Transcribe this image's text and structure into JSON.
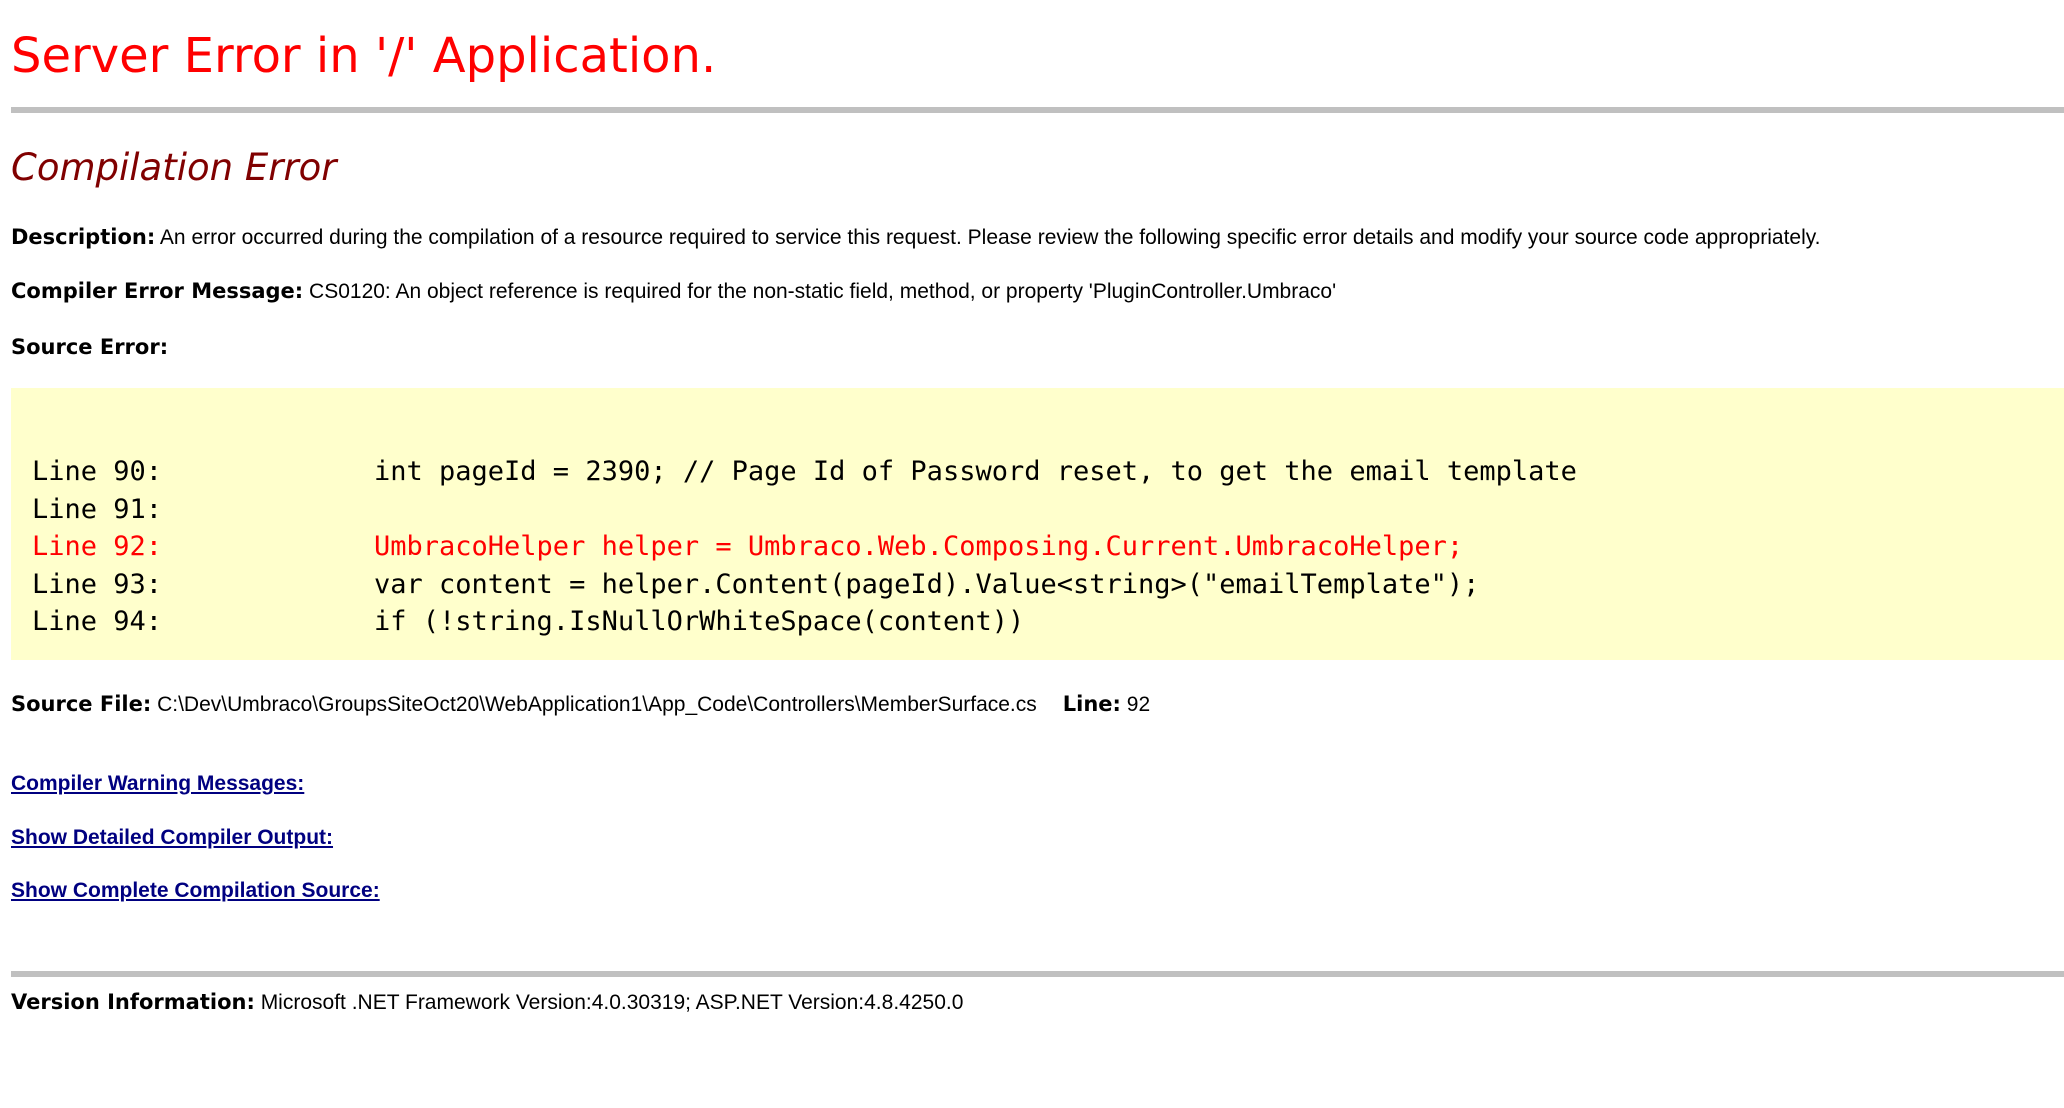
{
  "page": {
    "title": "Server Error in '/' Application.",
    "subtitle": "Compilation Error"
  },
  "description": {
    "label": "Description:",
    "text": "An error occurred during the compilation of a resource required to service this request. Please review the following specific error details and modify your source code appropriately."
  },
  "compiler_error": {
    "label": "Compiler Error Message:",
    "text": "CS0120: An object reference is required for the non-static field, method, or property 'PluginController.Umbraco'"
  },
  "source_error": {
    "label": "Source Error:",
    "lines": [
      {
        "number": "Line 90:",
        "code": "int pageId = 2390; // Page Id of Password reset, to get the email template",
        "is_error": false
      },
      {
        "number": "Line 91:",
        "code": "",
        "is_error": false
      },
      {
        "number": "Line 92:",
        "code": "UmbracoHelper helper = Umbraco.Web.Composing.Current.UmbracoHelper;",
        "is_error": true
      },
      {
        "number": "Line 93:",
        "code": "var content = helper.Content(pageId).Value<string>(\"emailTemplate\");",
        "is_error": false
      },
      {
        "number": "Line 94:",
        "code": "if (!string.IsNullOrWhiteSpace(content))",
        "is_error": false
      }
    ]
  },
  "source_file": {
    "label": "Source File:",
    "path": "C:\\Dev\\Umbraco\\GroupsSiteOct20\\WebApplication1\\App_Code\\Controllers\\MemberSurface.cs",
    "line_label": "Line:",
    "line": "92"
  },
  "links": {
    "warnings": "Compiler Warning Messages:",
    "detailed_output": "Show Detailed Compiler Output:",
    "complete_source": "Show Complete Compilation Source:"
  },
  "version": {
    "label": "Version Information:",
    "text": "Microsoft .NET Framework Version:4.0.30319; ASP.NET Version:4.8.4250.0"
  },
  "colors": {
    "title": "#ff0000",
    "subtitle": "#800000",
    "code_background": "#ffffcc",
    "error_line": "#ff0000",
    "link": "#000080",
    "rule": "#c0c0c0"
  }
}
